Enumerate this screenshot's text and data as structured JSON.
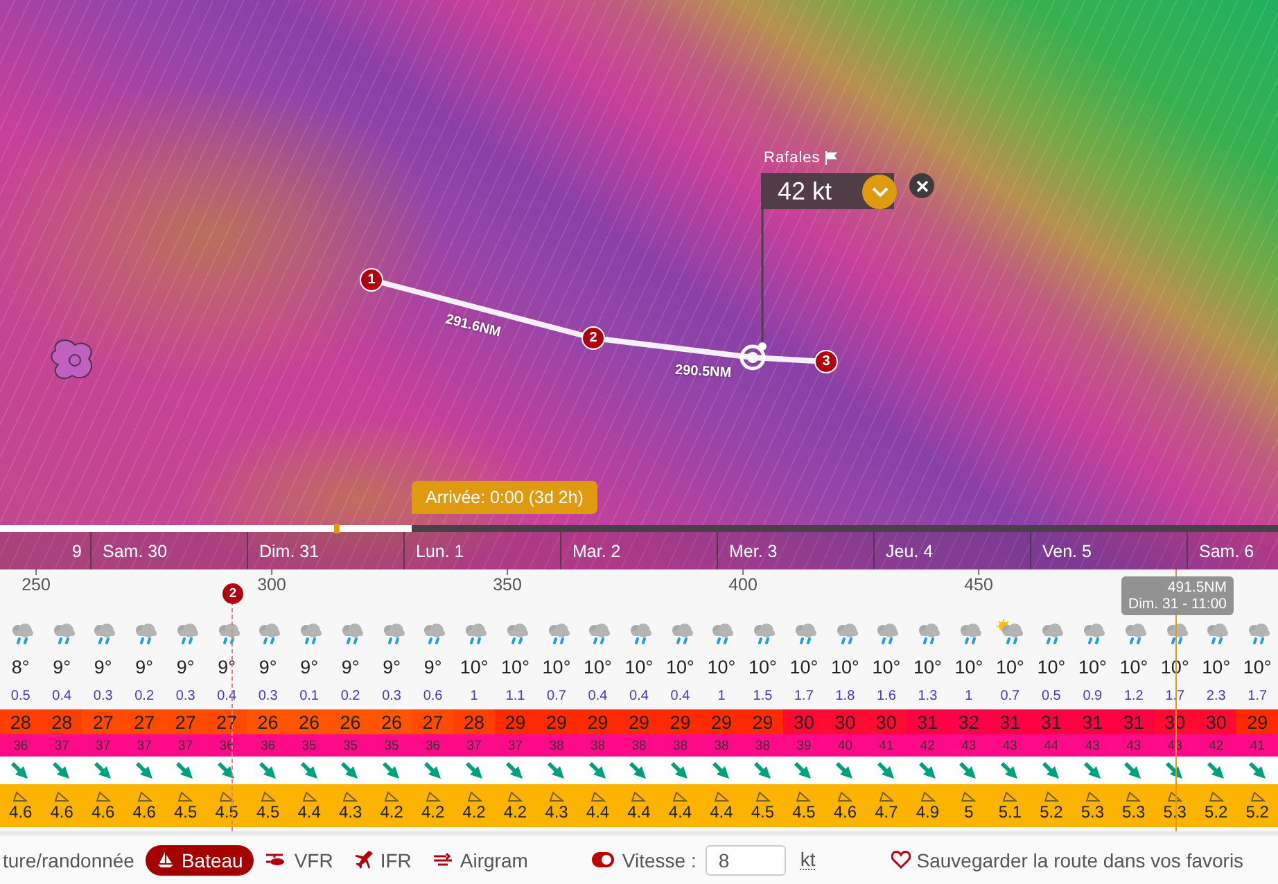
{
  "map": {
    "waypoints": [
      {
        "label": "1"
      },
      {
        "label": "2"
      },
      {
        "label": "3"
      }
    ],
    "legs": [
      {
        "distance": "291.6NM"
      },
      {
        "distance": "290.5NM"
      }
    ],
    "gust_popup": {
      "label": "Rafales",
      "value": "42 kt"
    }
  },
  "timeline": {
    "level": 0.322,
    "arrival": "Arrivée: 0:00 (3d 2h)",
    "days": [
      "9",
      "Sam. 30",
      "Dim. 31",
      "Lun. 1",
      "Mar. 2",
      "Mer. 3",
      "Jeu. 4",
      "Ven. 5",
      "Sam. 6"
    ]
  },
  "distance_axis": {
    "ticks": [
      "250",
      "300",
      "350",
      "400",
      "450"
    ],
    "waypoint_marker": "2",
    "cursor_tooltip": {
      "distance": "491.5NM",
      "time": "Dim. 31 - 11:00"
    }
  },
  "forecast": [
    {
      "kind": "rain",
      "temp": "8°",
      "rain": "0.5",
      "wind": "28",
      "color": "#ff3f00",
      "gust": "36",
      "wave": "4.6"
    },
    {
      "kind": "rain",
      "temp": "9°",
      "rain": "0.4",
      "wind": "28",
      "color": "#ff3f00",
      "gust": "37",
      "wave": "4.6"
    },
    {
      "kind": "rain",
      "temp": "9°",
      "rain": "0.3",
      "wind": "27",
      "color": "#ff4a00",
      "gust": "37",
      "wave": "4.6"
    },
    {
      "kind": "rain",
      "temp": "9°",
      "rain": "0.2",
      "wind": "27",
      "color": "#ff4a00",
      "gust": "37",
      "wave": "4.6"
    },
    {
      "kind": "rain",
      "temp": "9°",
      "rain": "0.3",
      "wind": "27",
      "color": "#ff4a00",
      "gust": "37",
      "wave": "4.5"
    },
    {
      "kind": "rain",
      "temp": "9°",
      "rain": "0.4",
      "wind": "27",
      "color": "#ff4a00",
      "gust": "36",
      "wave": "4.5"
    },
    {
      "kind": "rain",
      "temp": "9°",
      "rain": "0.3",
      "wind": "26",
      "color": "#ff5500",
      "gust": "36",
      "wave": "4.5"
    },
    {
      "kind": "rain",
      "temp": "9°",
      "rain": "0.1",
      "wind": "26",
      "color": "#ff5500",
      "gust": "35",
      "wave": "4.4"
    },
    {
      "kind": "rain",
      "temp": "9°",
      "rain": "0.2",
      "wind": "26",
      "color": "#ff5500",
      "gust": "35",
      "wave": "4.3"
    },
    {
      "kind": "rain",
      "temp": "9°",
      "rain": "0.3",
      "wind": "26",
      "color": "#ff5500",
      "gust": "35",
      "wave": "4.2"
    },
    {
      "kind": "rain",
      "temp": "9°",
      "rain": "0.6",
      "wind": "27",
      "color": "#ff4a00",
      "gust": "36",
      "wave": "4.2"
    },
    {
      "kind": "rain",
      "temp": "10°",
      "rain": "1",
      "wind": "28",
      "color": "#ff3f00",
      "gust": "37",
      "wave": "4.2"
    },
    {
      "kind": "rain",
      "temp": "10°",
      "rain": "1.1",
      "wind": "29",
      "color": "#ff2a00",
      "gust": "37",
      "wave": "4.2"
    },
    {
      "kind": "rain",
      "temp": "10°",
      "rain": "0.7",
      "wind": "29",
      "color": "#ff2a00",
      "gust": "38",
      "wave": "4.3"
    },
    {
      "kind": "rain",
      "temp": "10°",
      "rain": "0.4",
      "wind": "29",
      "color": "#ff2a00",
      "gust": "38",
      "wave": "4.4"
    },
    {
      "kind": "rain",
      "temp": "10°",
      "rain": "0.4",
      "wind": "29",
      "color": "#ff2a00",
      "gust": "38",
      "wave": "4.4"
    },
    {
      "kind": "rain",
      "temp": "10°",
      "rain": "0.4",
      "wind": "29",
      "color": "#ff2a00",
      "gust": "38",
      "wave": "4.4"
    },
    {
      "kind": "rain",
      "temp": "10°",
      "rain": "1",
      "wind": "29",
      "color": "#ff2a00",
      "gust": "38",
      "wave": "4.4"
    },
    {
      "kind": "rain",
      "temp": "10°",
      "rain": "1.5",
      "wind": "29",
      "color": "#ff2a00",
      "gust": "38",
      "wave": "4.5"
    },
    {
      "kind": "rain",
      "temp": "10°",
      "rain": "1.7",
      "wind": "30",
      "color": "#ff0a30",
      "gust": "39",
      "wave": "4.5"
    },
    {
      "kind": "rain",
      "temp": "10°",
      "rain": "1.8",
      "wind": "30",
      "color": "#ff0a30",
      "gust": "40",
      "wave": "4.6"
    },
    {
      "kind": "rain",
      "temp": "10°",
      "rain": "1.6",
      "wind": "30",
      "color": "#ff0a30",
      "gust": "41",
      "wave": "4.7"
    },
    {
      "kind": "rain",
      "temp": "10°",
      "rain": "1.3",
      "wind": "31",
      "color": "#ff0040",
      "gust": "42",
      "wave": "4.9"
    },
    {
      "kind": "rain",
      "temp": "10°",
      "rain": "1",
      "wind": "32",
      "color": "#ff0048",
      "gust": "43",
      "wave": "5"
    },
    {
      "kind": "sun-rain",
      "temp": "10°",
      "rain": "0.7",
      "wind": "31",
      "color": "#ff0040",
      "gust": "43",
      "wave": "5.1"
    },
    {
      "kind": "rain",
      "temp": "10°",
      "rain": "0.5",
      "wind": "31",
      "color": "#ff0040",
      "gust": "44",
      "wave": "5.2"
    },
    {
      "kind": "rain",
      "temp": "10°",
      "rain": "0.9",
      "wind": "31",
      "color": "#ff0040",
      "gust": "43",
      "wave": "5.3"
    },
    {
      "kind": "rain",
      "temp": "10°",
      "rain": "1.2",
      "wind": "31",
      "color": "#ff0040",
      "gust": "43",
      "wave": "5.3"
    },
    {
      "kind": "rain",
      "temp": "10°",
      "rain": "1.7",
      "wind": "30",
      "color": "#ff0a30",
      "gust": "43",
      "wave": "5.3"
    },
    {
      "kind": "rain",
      "temp": "10°",
      "rain": "2.3",
      "wind": "30",
      "color": "#ff0a30",
      "gust": "42",
      "wave": "5.2"
    },
    {
      "kind": "rain",
      "temp": "10°",
      "rain": "1.7",
      "wind": "29",
      "color": "#ff2a00",
      "gust": "41",
      "wave": "5.2"
    }
  ],
  "modes": [
    {
      "label": "ture/randonnée",
      "kind": "text",
      "selected": false
    },
    {
      "label": "Bateau",
      "kind": "boat",
      "selected": true
    },
    {
      "label": "VFR",
      "kind": "helicopter",
      "selected": false
    },
    {
      "label": "IFR",
      "kind": "plane",
      "selected": false
    },
    {
      "label": "Airgram",
      "kind": "airgram",
      "selected": false
    }
  ],
  "speed": {
    "on": true,
    "label": "Vitesse :",
    "value": "8",
    "unit": "kt"
  },
  "save_link": "Sauvegarder la route dans vos favoris"
}
